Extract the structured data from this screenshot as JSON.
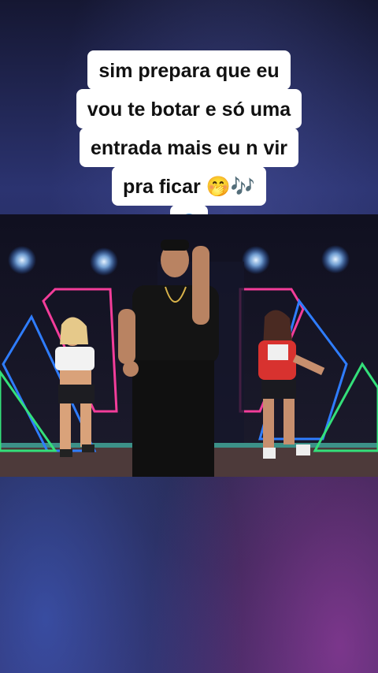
{
  "caption": {
    "lines": [
      "sim prepara que eu",
      "vou te botar e só uma",
      "entrada mais eu n vir",
      "pra ficar"
    ],
    "emoji_line4": [
      "🤭",
      "🎶"
    ],
    "emoji_line5": "😱"
  },
  "video": {
    "scene": "dance-studio-neon",
    "accent_colors": {
      "neon_pink": "#ff3fa0",
      "neon_blue": "#2f7dff",
      "neon_green": "#34e07a",
      "stage_light": "#cfe6ff"
    }
  }
}
